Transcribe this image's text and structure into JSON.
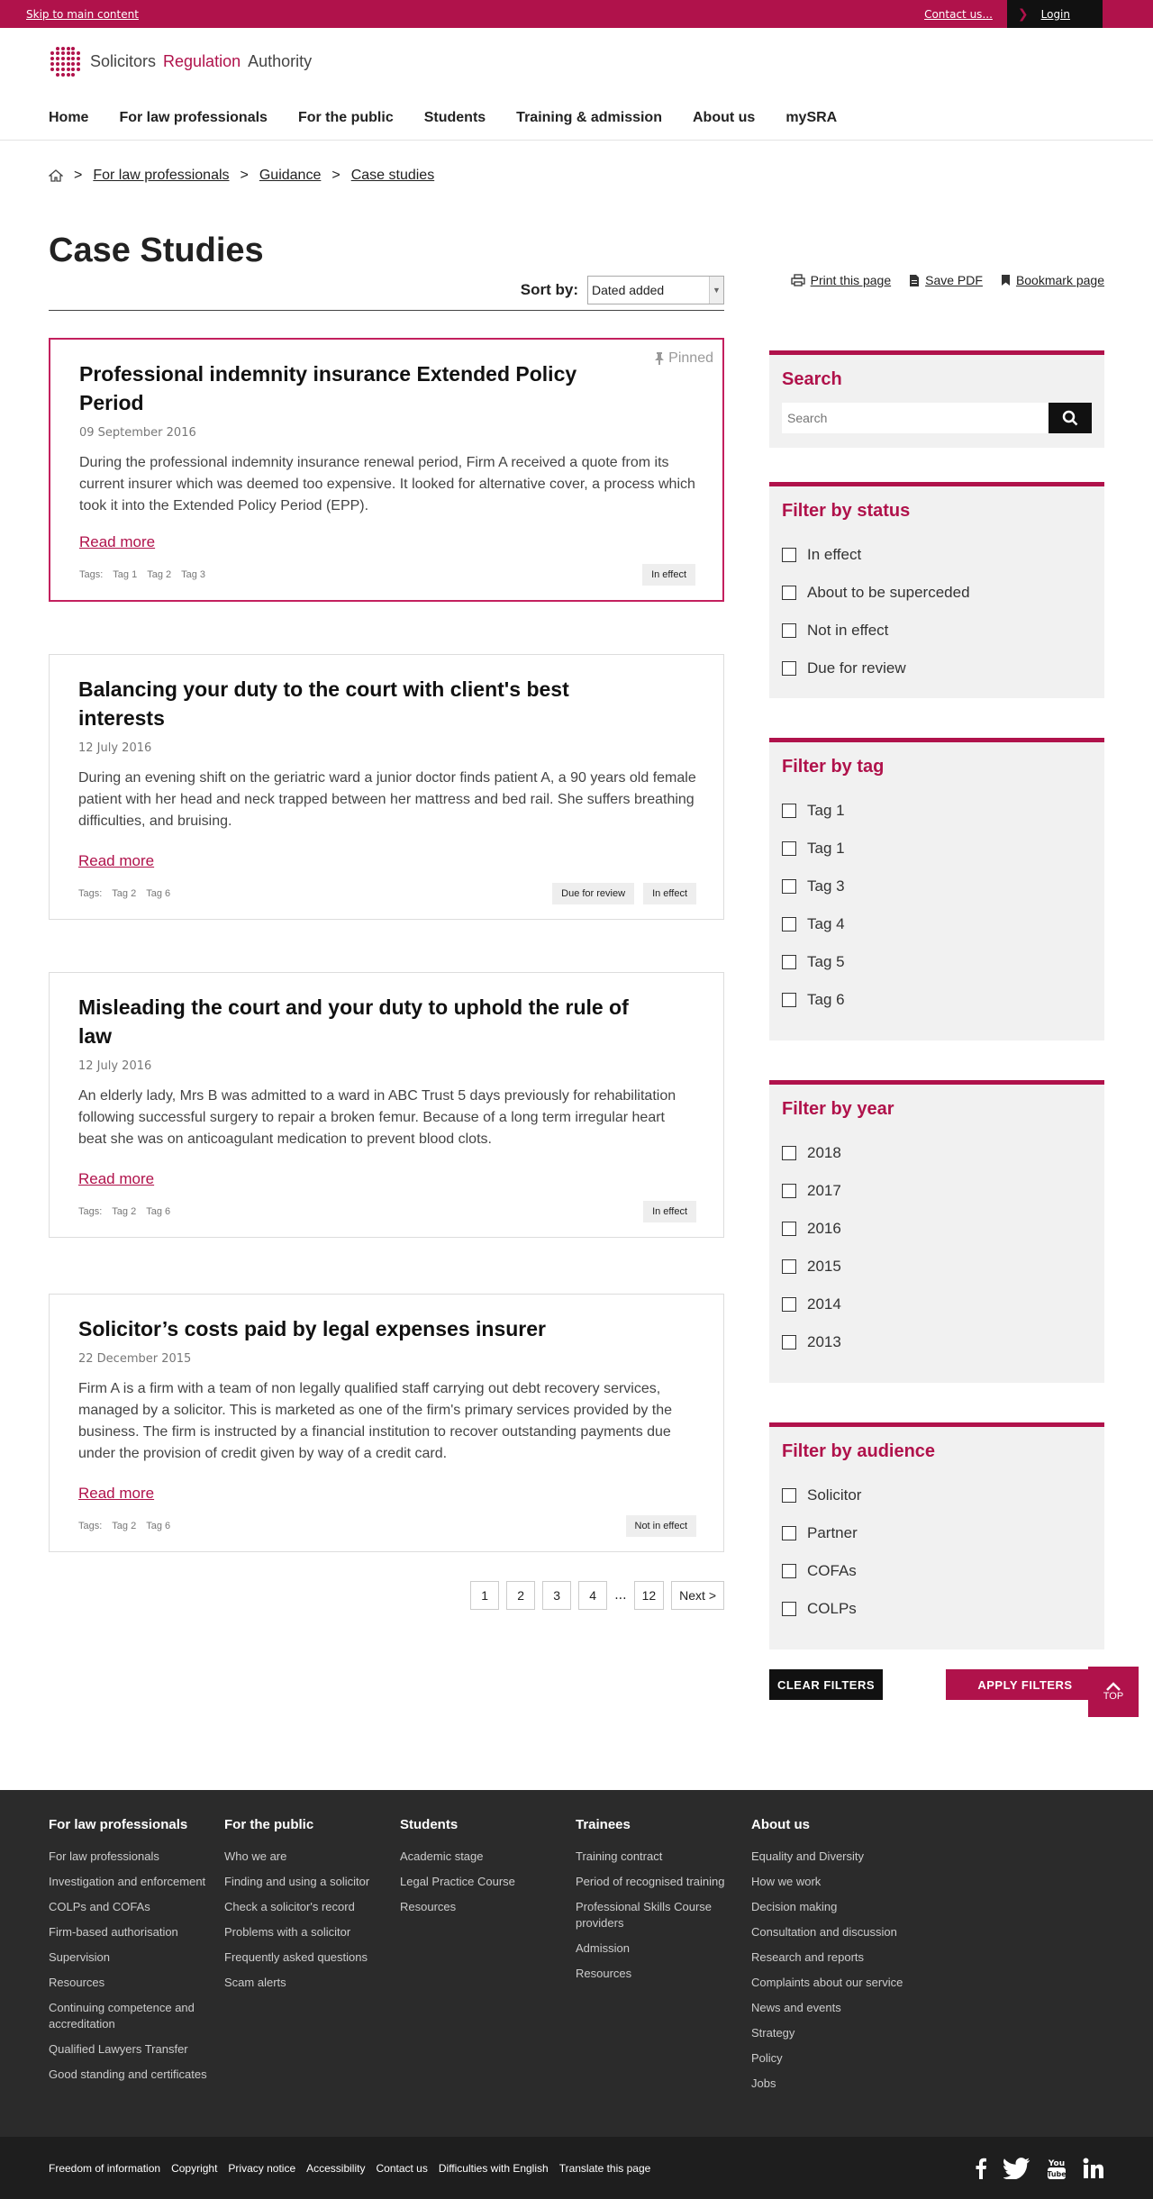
{
  "topbar": {
    "skip": "Skip to main content",
    "contact": "Contact us...",
    "login": "Login"
  },
  "logo": {
    "part1": "Solicitors",
    "part2": "Regulation",
    "part3": "Authority"
  },
  "nav": [
    "Home",
    "For law professionals",
    "For the public",
    "Students",
    "Training & admission",
    "About us",
    "mySRA"
  ],
  "breadcrumb": {
    "items": [
      "For law professionals",
      "Guidance",
      "Case studies"
    ],
    "separator": ">"
  },
  "page": {
    "title": "Case Studies",
    "sort_label": "Sort by:",
    "sort_value": "Dated added"
  },
  "cards": [
    {
      "title": "Professional indemnity insurance Extended Policy Period",
      "date": "09 September 2016",
      "excerpt": "During the professional indemnity insurance renewal period, Firm A received a quote from its current insurer which was deemed too expensive. It looked for alternative cover, a process which took it into the Extended Policy Period (EPP).",
      "more": "Read more",
      "tags_label": "Tags:",
      "tags": [
        "Tag 1",
        "Tag 2",
        "Tag 3"
      ],
      "badges": [
        "In effect"
      ],
      "pinned": "Pinned"
    },
    {
      "title": "Balancing your duty to the court with client's best interests",
      "date": "12 July 2016",
      "excerpt": "During an evening shift on the geriatric ward a junior doctor finds patient A, a 90 years old female patient with her head and neck trapped between her mattress and bed rail. She suffers breathing difficulties, and bruising.",
      "more": "Read more",
      "tags_label": "Tags:",
      "tags": [
        "Tag 2",
        "Tag 6"
      ],
      "badges": [
        "Due for review",
        "In effect"
      ]
    },
    {
      "title": "Misleading the court and your duty to uphold the rule of law",
      "date": "12 July 2016",
      "excerpt": "An elderly lady, Mrs B was admitted to a ward in ABC Trust 5 days previously for rehabilitation following successful surgery to repair a broken femur. Because of a long term irregular heart beat she was on anticoagulant medication to prevent blood clots.",
      "more": "Read more",
      "tags_label": "Tags:",
      "tags": [
        "Tag 2",
        "Tag 6"
      ],
      "badges": [
        "In effect"
      ]
    },
    {
      "title": "Solicitor’s costs paid by legal expenses insurer",
      "date": "22 December 2015",
      "excerpt": "Firm A is a firm with a team of non legally qualified staff carrying out debt recovery services, managed by a solicitor. This is marketed as one of the firm's primary services provided by the business. The firm is instructed by a financial institution to recover outstanding payments due under the provision of credit given by way of a credit card.",
      "more": "Read more",
      "tags_label": "Tags:",
      "tags": [
        "Tag 2",
        "Tag 6"
      ],
      "badges": [
        "Not in effect"
      ]
    }
  ],
  "pagination": {
    "pages": [
      "1",
      "2",
      "3",
      "4"
    ],
    "ellipsis": "...",
    "last": "12",
    "next": "Next >"
  },
  "utility": {
    "print": "Print this page",
    "pdf": "Save PDF",
    "bookmark": "Bookmark page"
  },
  "search": {
    "title": "Search",
    "placeholder": "Search"
  },
  "filters": [
    {
      "title": "Filter by status",
      "options": [
        "In effect",
        "About to be superceded",
        "Not in effect",
        "Due for review"
      ]
    },
    {
      "title": "Filter by tag",
      "options": [
        "Tag 1",
        "Tag 1",
        "Tag 3",
        "Tag 4",
        "Tag 5",
        "Tag 6"
      ]
    },
    {
      "title": "Filter by year",
      "options": [
        "2018",
        "2017",
        "2016",
        "2015",
        "2014",
        "2013"
      ]
    },
    {
      "title": "Filter by audience",
      "options": [
        "Solicitor",
        "Partner",
        "COFAs",
        "COLPs"
      ]
    }
  ],
  "filter_buttons": {
    "clear": "CLEAR FILTERS",
    "apply": "APPLY FILTERS"
  },
  "top_button": "TOP",
  "footer": [
    {
      "title": "For law professionals",
      "links": [
        "For law professionals",
        "Investigation and enforcement",
        "COLPs and COFAs",
        "Firm-based authorisation",
        "Supervision",
        "Resources",
        "Continuing competence and accreditation",
        "Qualified Lawyers Transfer",
        "Good standing and certificates"
      ]
    },
    {
      "title": "For the public",
      "links": [
        "Who we are",
        "Finding and using a solicitor",
        "Check a solicitor's record",
        "Problems with a solicitor",
        "Frequently asked questions",
        "Scam alerts"
      ]
    },
    {
      "title": "Students",
      "links": [
        "Academic stage",
        "Legal Practice Course",
        "Resources"
      ]
    },
    {
      "title": "Trainees",
      "links": [
        "Training contract",
        "Period of recognised training",
        "Professional Skills Course providers",
        "Admission",
        "Resources"
      ]
    },
    {
      "title": "About us",
      "links": [
        "Equality and Diversity",
        "How we work",
        "Decision making",
        "Consultation and discussion",
        "Research and reports",
        "Complaints about our service",
        "News and events",
        "Strategy",
        "Policy",
        "Jobs"
      ]
    }
  ],
  "subfooter": [
    "Freedom of information",
    "Copyright",
    "Privacy notice",
    "Accessibility",
    "Contact us",
    "Difficulties with English",
    "Translate this page"
  ],
  "colors": {
    "brand": "#b0124b",
    "dark": "#2b2b2b"
  }
}
